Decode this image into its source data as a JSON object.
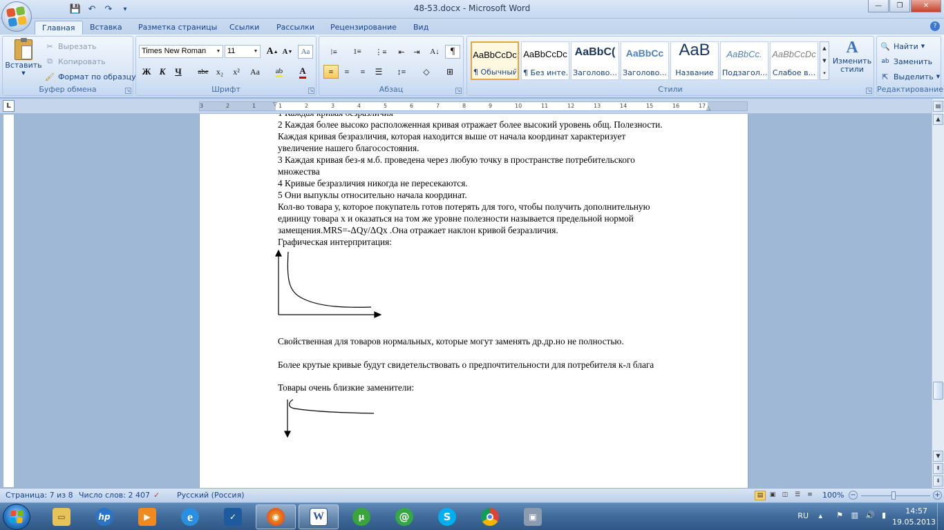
{
  "window": {
    "title": "48-53.docx - Microsoft Word",
    "minimize": "—",
    "maximize": "❐",
    "close": "✕"
  },
  "qat": {
    "save": "💾",
    "undo": "↶",
    "redo": "↷",
    "customize": "▾"
  },
  "tabs": [
    "Главная",
    "Вставка",
    "Разметка страницы",
    "Ссылки",
    "Рассылки",
    "Рецензирование",
    "Вид"
  ],
  "ribbon": {
    "clipboard": {
      "label": "Буфер обмена",
      "paste": "Вставить",
      "cut": "Вырезать",
      "copy": "Копировать",
      "format_painter": "Формат по образцу"
    },
    "font": {
      "label": "Шрифт",
      "font_name": "Times New Roman",
      "font_size": "11",
      "grow": "A",
      "shrink": "A",
      "bold": "Ж",
      "italic": "К",
      "underline": "Ч",
      "strike": "abe",
      "subscript": "x₂",
      "superscript": "x²",
      "case": "Aa",
      "highlight": "ab",
      "color": "A"
    },
    "paragraph": {
      "label": "Абзац",
      "show_marks": "¶"
    },
    "styles": {
      "label": "Стили",
      "change_styles": "Изменить стили",
      "items": [
        {
          "sample": "AaBbCcDc",
          "name": "¶ Обычный"
        },
        {
          "sample": "AaBbCcDc",
          "name": "¶ Без инте..."
        },
        {
          "sample": "AaBbC(",
          "name": "Заголово..."
        },
        {
          "sample": "AaBbCc",
          "name": "Заголово..."
        },
        {
          "sample": "AaB",
          "name": "Название"
        },
        {
          "sample": "AaBbCc.",
          "name": "Подзагол..."
        },
        {
          "sample": "AaBbCcDc",
          "name": "Слабое в..."
        }
      ]
    },
    "editing": {
      "label": "Редактирование",
      "find": "Найти",
      "replace": "Заменить",
      "select": "Выделить"
    }
  },
  "ruler": {
    "corner": "L",
    "ticks": [
      "3",
      "2",
      "1",
      "1",
      "2",
      "3",
      "4",
      "5",
      "6",
      "7",
      "8",
      "9",
      "10",
      "11",
      "12",
      "13",
      "14",
      "15",
      "16",
      "17"
    ]
  },
  "document": {
    "lines": [
      "2 Каждая более высоко расположенная кривая отражает более высокий уровень общ. Полезности.",
      "Каждая кривая безразличия, которая находится выше от начала координат характеризует",
      "увеличение нашего благосостояния.",
      "3 Каждая кривая без-я м.б. проведена через любую точку в пространстве потребительского",
      "множества",
      "4 Кривые безразличия никогда не пересекаются.",
      "5 Они выпуклы относительно начала координат.",
      "Кол-во товара у, которое покупатель готов потерять для того, чтобы получить дополнительную",
      "единицу товара х и оказаться на том же уровне полезности называется предельной нормой",
      "замещения.MRS=-ΔQy/ΔQx .Она отражает  наклон кривой безразличия.",
      "Графическая интерпритация:"
    ],
    "para_normal": "Свойственная для товаров нормальных, которые могут заменять др.др.но не полностью.",
    "para_steep": "Более крутые кривые будут свидетельствовать о предпочтительности для потребителя к-л блага",
    "para_close": "Товары очень близкие заменители:"
  },
  "status": {
    "page": "Страница: 7 из 8",
    "words": "Число слов: 2 407",
    "language": "Русский (Россия)",
    "zoom": "100%"
  },
  "taskbar": {
    "apps": [
      "explorer-icon",
      "hp-icon",
      "media-player-icon",
      "internet-explorer-icon",
      "app-icon",
      "firefox-icon",
      "word-icon",
      "utorrent-icon",
      "agent-icon",
      "skype-icon",
      "chrome-icon",
      "scanner-icon"
    ],
    "lang": "RU",
    "time": "14:57",
    "date": "19.05.2013"
  },
  "colors": {
    "accent": "#15428b",
    "ribbon": "#dbe7f6",
    "taskbar": "#3f6a9a",
    "page": "#ffffff"
  }
}
